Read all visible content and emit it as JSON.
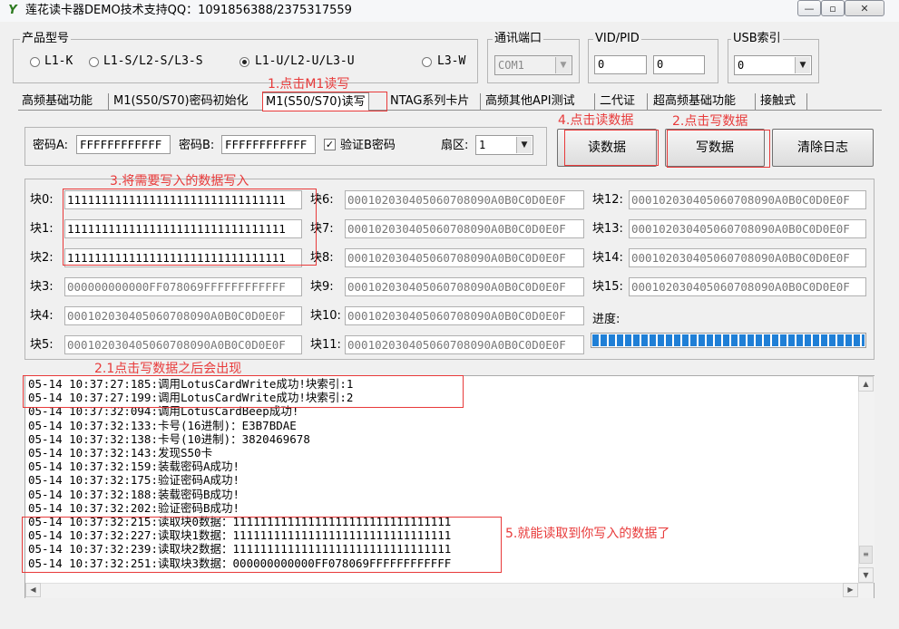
{
  "window": {
    "title": "莲花读卡器DEMO技术支持QQ：1091856388/2375317559",
    "btn_min": "—",
    "btn_max": "▫",
    "btn_close": "✕"
  },
  "product": {
    "group_label": "产品型号",
    "options": [
      "L1-K",
      "L1-S/L2-S/L3-S",
      "L1-U/L2-U/L3-U",
      "L3-W"
    ],
    "selected_index": 2
  },
  "port": {
    "group_label": "通讯端口",
    "value": "COM1"
  },
  "vidpid": {
    "group_label": "VID/PID",
    "vid": "0",
    "pid": "0"
  },
  "usb": {
    "group_label": "USB索引",
    "value": "0"
  },
  "tabs": [
    "高频基础功能",
    "M1(S50/S70)密码初始化",
    "M1(S50/S70)读写",
    "NTAG系列卡片",
    "高频其他API测试",
    "二代证",
    "超高频基础功能",
    "接触式"
  ],
  "active_tab": 2,
  "keys": {
    "key_a_label": "密码A:",
    "key_a_value": "FFFFFFFFFFFF",
    "key_b_label": "密码B:",
    "key_b_value": "FFFFFFFFFFFF",
    "verify_b_label": "验证B密码",
    "verify_b_checked": true,
    "sector_label": "扇区:",
    "sector_value": "1"
  },
  "buttons": {
    "read": "读数据",
    "write": "写数据",
    "clear": "清除日志"
  },
  "blocks": [
    {
      "label": "块0:",
      "value": "11111111111111111111111111111111"
    },
    {
      "label": "块1:",
      "value": "11111111111111111111111111111111"
    },
    {
      "label": "块2:",
      "value": "11111111111111111111111111111111"
    },
    {
      "label": "块3:",
      "value": "000000000000FF078069FFFFFFFFFFFF"
    },
    {
      "label": "块4:",
      "value": "000102030405060708090A0B0C0D0E0F"
    },
    {
      "label": "块5:",
      "value": "000102030405060708090A0B0C0D0E0F"
    },
    {
      "label": "块6:",
      "value": "000102030405060708090A0B0C0D0E0F"
    },
    {
      "label": "块7:",
      "value": "000102030405060708090A0B0C0D0E0F"
    },
    {
      "label": "块8:",
      "value": "000102030405060708090A0B0C0D0E0F"
    },
    {
      "label": "块9:",
      "value": "000102030405060708090A0B0C0D0E0F"
    },
    {
      "label": "块10:",
      "value": "000102030405060708090A0B0C0D0E0F"
    },
    {
      "label": "块11:",
      "value": "000102030405060708090A0B0C0D0E0F"
    },
    {
      "label": "块12:",
      "value": "000102030405060708090A0B0C0D0E0F"
    },
    {
      "label": "块13:",
      "value": "000102030405060708090A0B0C0D0E0F"
    },
    {
      "label": "块14:",
      "value": "000102030405060708090A0B0C0D0E0F"
    },
    {
      "label": "块15:",
      "value": "000102030405060708090A0B0C0D0E0F"
    }
  ],
  "progress": {
    "label": "进度:",
    "value": 1.0,
    "color": "#1f7fd6"
  },
  "log": [
    "05-14 10:37:27:185:调用LotusCardWrite成功!块索引:1",
    "05-14 10:37:27:199:调用LotusCardWrite成功!块索引:2",
    "05-14 10:37:32:094:调用LotusCardBeep成功!",
    "05-14 10:37:32:133:卡号(16进制)：E3B7BDAE",
    "05-14 10:37:32:138:卡号(10进制)：3820469678",
    "05-14 10:37:32:143:发现S50卡",
    "05-14 10:37:32:159:装载密码A成功!",
    "05-14 10:37:32:175:验证密码A成功!",
    "05-14 10:37:32:188:装载密码B成功!",
    "05-14 10:37:32:202:验证密码B成功!",
    "05-14 10:37:32:215:读取块0数据：11111111111111111111111111111111",
    "05-14 10:37:32:227:读取块1数据：11111111111111111111111111111111",
    "05-14 10:37:32:239:读取块2数据：11111111111111111111111111111111",
    "05-14 10:37:32:251:读取块3数据：000000000000FF078069FFFFFFFFFFFF"
  ],
  "annotations": {
    "step1": "1.点击M1读写",
    "step2": "2.点击写数据",
    "step2_1": "2.1点击写数据之后会出现",
    "step3": "3.将需要写入的数据写入",
    "step4": "4.点击读数据",
    "step5": "5.就能读取到你写入的数据了",
    "color": "#e83a3a"
  }
}
